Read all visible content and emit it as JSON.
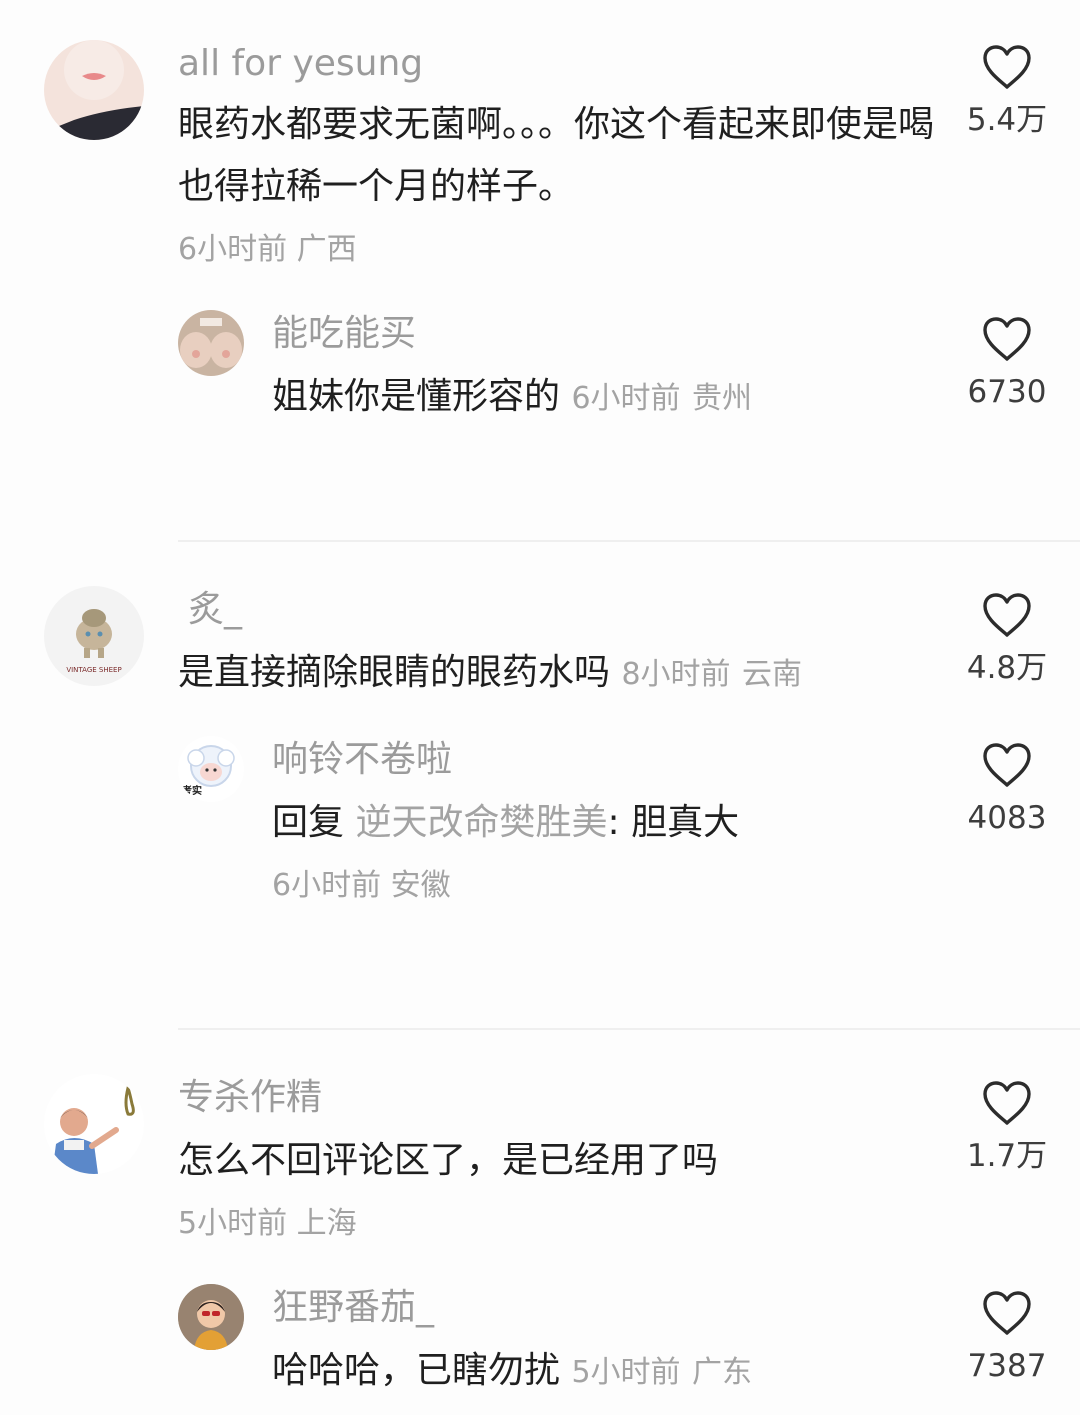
{
  "comments": [
    {
      "user": "all for yesung",
      "text": "眼药水都要求无菌啊。。。你这个看起来即使是喝也得拉稀一个月的样子。",
      "time": "6小时前",
      "location": "广西",
      "likes": "5.4万",
      "reply": {
        "user": "能吃能买",
        "text": "姐妹你是懂形容的",
        "time": "6小时前",
        "location": "贵州",
        "likes": "6730"
      }
    },
    {
      "user": "炙_",
      "text": "是直接摘除眼睛的眼药水吗",
      "time": "8小时前",
      "location": "云南",
      "likes": "4.8万",
      "avatar_text": "VINTAGE SHEEP",
      "reply": {
        "user": "响铃不卷啦",
        "reply_prefix": "回复",
        "reply_target": "逆天改命樊胜美",
        "separator": ":",
        "text": "胆真大",
        "time": "6小时前",
        "location": "安徽",
        "likes": "4083",
        "avatar_text": "考实"
      }
    },
    {
      "user": "专杀作精",
      "text": "怎么不回评论区了，是已经用了吗",
      "time": "5小时前",
      "location": "上海",
      "likes": "1.7万",
      "reply": {
        "user": "狂野番茄_",
        "text": "哈哈哈，已瞎勿扰",
        "time": "5小时前",
        "location": "广东",
        "likes": "7387"
      }
    }
  ],
  "icons": {
    "like": "heart-outline-icon"
  },
  "colors": {
    "username": "#9b9b9b",
    "text": "#1f1f1f",
    "meta": "#a3a3a3",
    "divider": "#efefef"
  }
}
